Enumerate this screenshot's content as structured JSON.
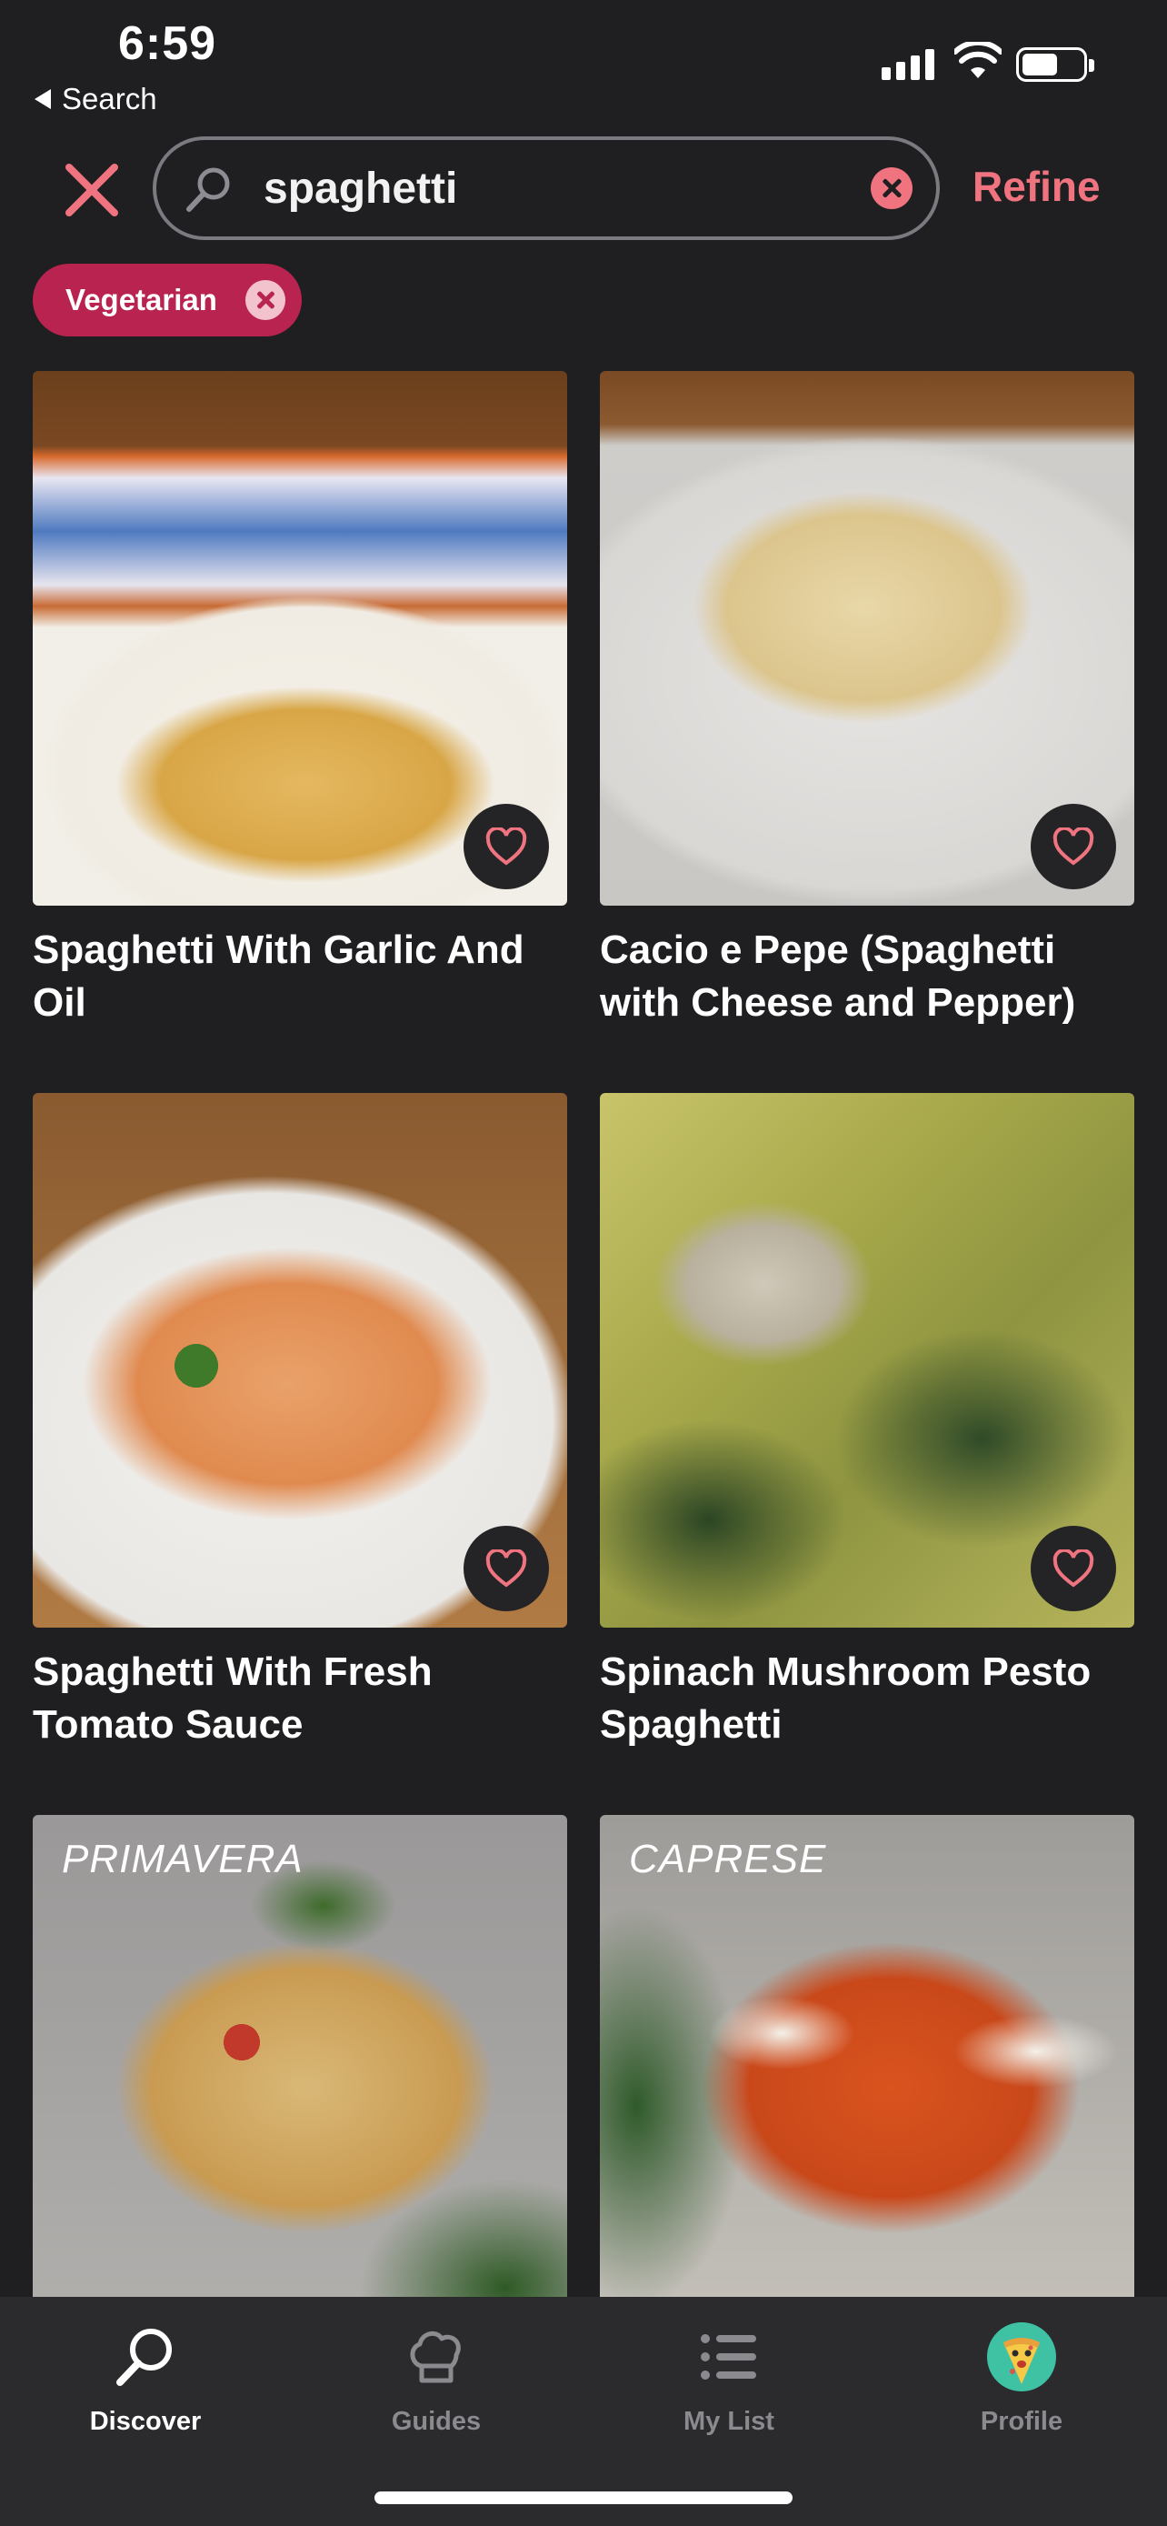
{
  "status_bar": {
    "time": "6:59",
    "back_label": "Search"
  },
  "search": {
    "query": "spaghetti",
    "refine_label": "Refine"
  },
  "filters": [
    {
      "label": "Vegetarian"
    }
  ],
  "recipes": [
    {
      "title": "Spaghetti With Garlic And Oil",
      "overlay": ""
    },
    {
      "title": "Cacio e Pepe (Spaghetti with Cheese and Pepper)",
      "overlay": ""
    },
    {
      "title": "Spaghetti With Fresh Tomato Sauce",
      "overlay": ""
    },
    {
      "title": "Spinach Mushroom Pesto Spaghetti",
      "overlay": ""
    },
    {
      "title": "",
      "overlay": "PRIMAVERA"
    },
    {
      "title": "",
      "overlay": "CAPRESE"
    }
  ],
  "tabs": [
    {
      "label": "Discover",
      "icon": "search-icon",
      "active": true
    },
    {
      "label": "Guides",
      "icon": "chef-hat-icon",
      "active": false
    },
    {
      "label": "My List",
      "icon": "list-icon",
      "active": false
    },
    {
      "label": "Profile",
      "icon": "avatar",
      "active": false
    }
  ],
  "colors": {
    "accent": "#f07480",
    "chip": "#b8244f",
    "background": "#1f1f22"
  }
}
